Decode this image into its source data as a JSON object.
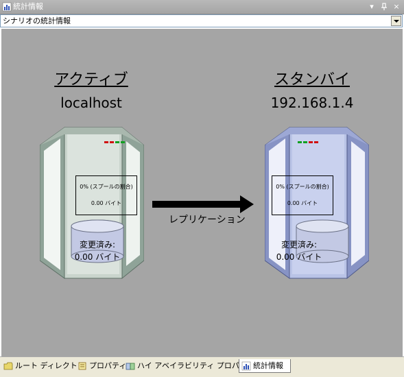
{
  "window": {
    "title": "統計情報",
    "buttons": {
      "dropdown": "▾",
      "pin": "ᵖ",
      "close": "×"
    }
  },
  "scenario_select": {
    "value": "シナリオの統計情報"
  },
  "active": {
    "heading": "アクティブ",
    "host": "localhost",
    "spool_pct": "0% (スプールの割合)",
    "spool_bytes": "0.00 バイト",
    "changed_label": "変更済み:",
    "changed_value": "0.00 バイト"
  },
  "standby": {
    "heading": "スタンバイ",
    "host": "192.168.1.4",
    "spool_pct": "0% (スプールの割合)",
    "spool_bytes": "0.00 バイト",
    "changed_label": "変更済み:",
    "changed_value": "0.00 バイト"
  },
  "replication": {
    "label": "レプリケーション"
  },
  "tabs": [
    {
      "label": "ルート ディレクトリ",
      "icon": "folder-icon"
    },
    {
      "label": "プロパティ",
      "icon": "properties-icon"
    },
    {
      "label": "ハイ アベイラビリティ プロパティ",
      "icon": "ha-properties-icon"
    },
    {
      "label": "統計情報",
      "icon": "statistics-icon",
      "active": true
    }
  ],
  "colors": {
    "panel_bg": "#a5a5a5",
    "active_server": "#c9d4cc",
    "standby_server": "#b9c3e6",
    "led_red": "#d01010",
    "led_green": "#10a020"
  }
}
